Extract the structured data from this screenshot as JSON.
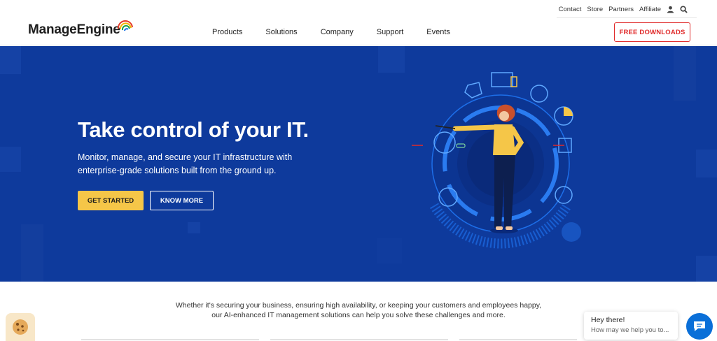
{
  "header": {
    "logo_text": "ManageEngine",
    "util_nav": [
      "Contact",
      "Store",
      "Partners",
      "Affiliate"
    ],
    "main_nav": [
      "Products",
      "Solutions",
      "Company",
      "Support",
      "Events"
    ],
    "free_downloads": "FREE DOWNLOADS",
    "icons": [
      "user-icon",
      "search-icon"
    ]
  },
  "hero": {
    "title": "Take control of your IT.",
    "subtitle": "Monitor, manage, and secure your IT infrastructure with enterprise-grade solutions built from the ground up.",
    "get_started": "GET STARTED",
    "know_more": "KNOW MORE"
  },
  "intro": {
    "line1": "Whether it's securing your business, ensuring high availability, or keeping your customers and employees happy,",
    "line2": "our AI-enhanced IT management solutions can help you solve these challenges and more."
  },
  "chat": {
    "greeting": "Hey there!",
    "prompt": "How may we help you to..."
  },
  "colors": {
    "hero_bg": "#0e3a9c",
    "accent_red": "#e02a2a",
    "accent_yellow": "#f5c648",
    "chat_blue": "#0a6fd8"
  }
}
